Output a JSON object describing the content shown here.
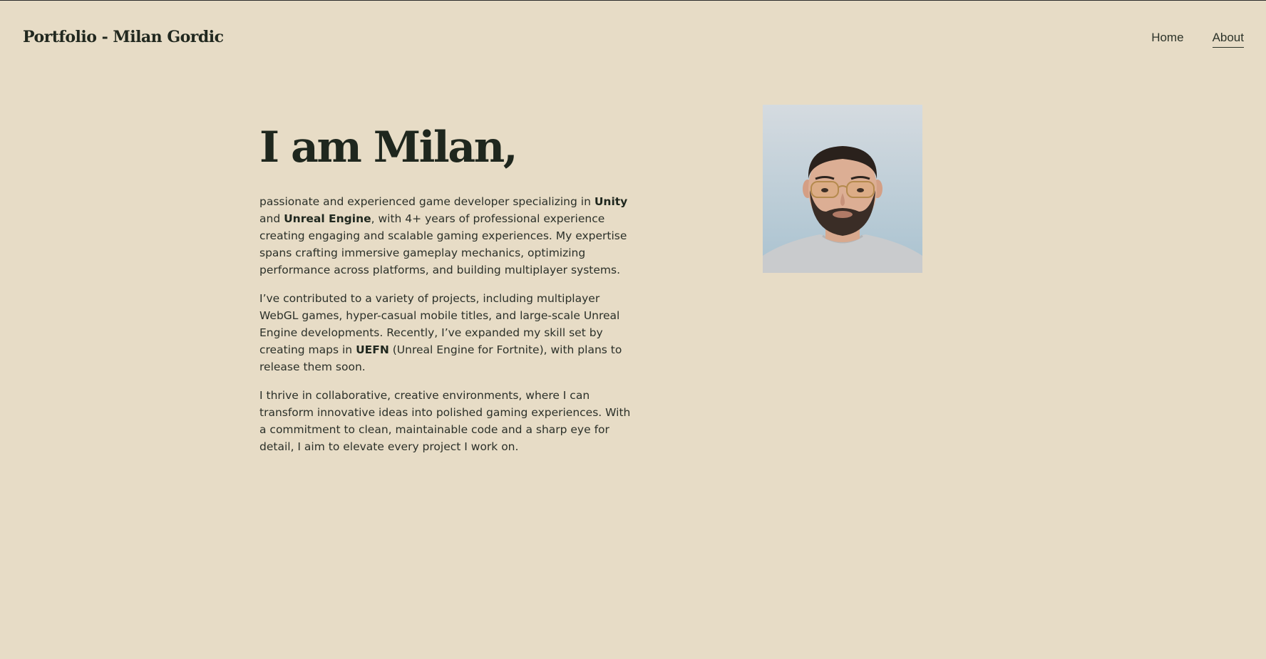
{
  "header": {
    "site_title": "Portfolio - Milan Gordic",
    "nav": {
      "home": "Home",
      "about": "About"
    }
  },
  "about": {
    "heading": "I am Milan,",
    "paragraph1": {
      "t1": "passionate and experienced game developer specializing in ",
      "b1": "Unity",
      "t2": " and ",
      "b2": "Unreal Engine",
      "t3": ", with 4+ years of professional experience creating engaging and scalable gaming experiences. My expertise spans crafting immersive gameplay mechanics, optimizing performance across platforms, and building multiplayer systems."
    },
    "paragraph2": {
      "t1": "I’ve contributed to a variety of projects, including multiplayer WebGL games, hyper-casual mobile titles, and large-scale Unreal Engine developments. Recently, I’ve expanded my skill set by creating maps in ",
      "b1": "UEFN",
      "t2": " (Unreal Engine for Fortnite), with plans to release them soon."
    },
    "paragraph3": "I thrive in collaborative, creative environments, where I can transform innovative ideas into polished gaming experiences. With a commitment to clean, maintainable code and a sharp eye for detail, I aim to elevate every project I work on."
  },
  "colors": {
    "background": "#e7dcc6",
    "text": "#2a2f27",
    "heading": "#1f271e"
  }
}
